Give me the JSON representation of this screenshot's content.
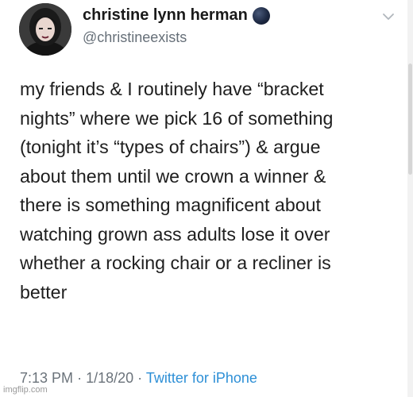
{
  "author": {
    "display_name": "christine lynn herman",
    "handle": "@christineexists",
    "badge_icon": "moon-icon",
    "avatar_icon": "profile-photo"
  },
  "tweet": {
    "lines": [
      "my friends & I routinely have “bracket",
      "nights” where we pick 16 of something",
      "(tonight it’s “types of chairs”) & argue",
      "about them until we crown a winner &",
      "there is something magnificent about",
      "watching grown ass adults lose it over",
      "whether a rocking chair or a recliner is",
      "better"
    ]
  },
  "meta": {
    "time": "7:13 PM",
    "separator": "·",
    "date": "1/18/20",
    "source": "Twitter for iPhone"
  },
  "menu": {
    "icon": "chevron-down-icon"
  },
  "watermark": "imgflip.com",
  "colors": {
    "text": "#1e1e1e",
    "secondary": "#666f78",
    "link": "#2d8fd6"
  }
}
